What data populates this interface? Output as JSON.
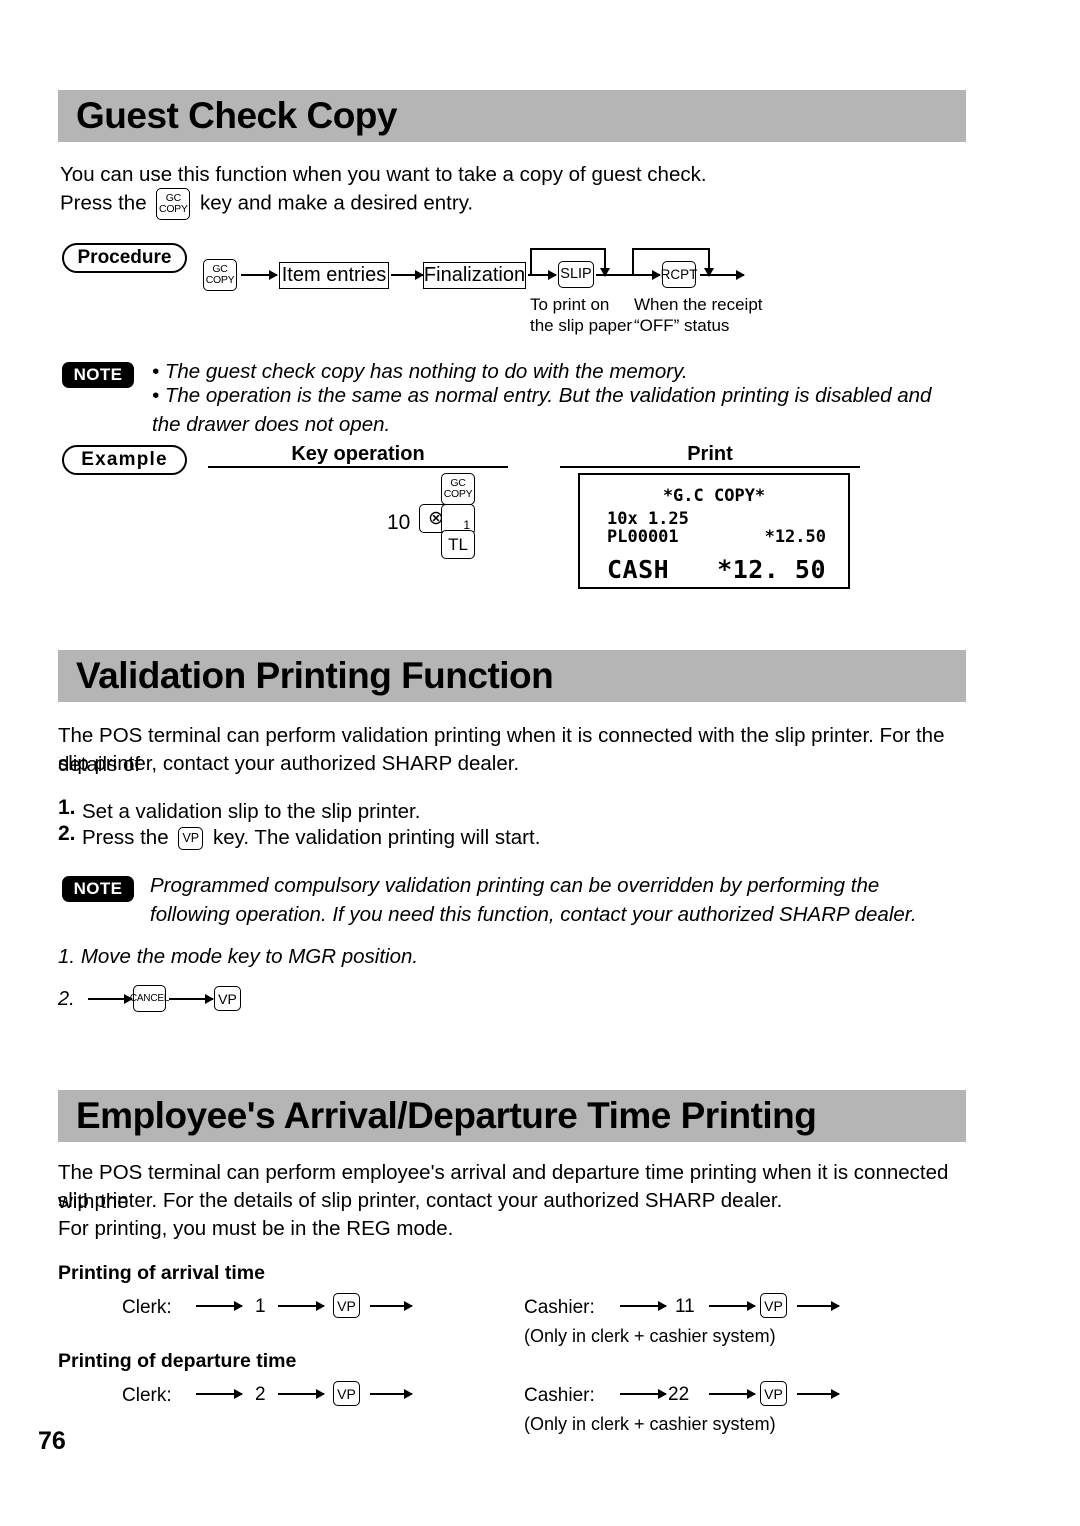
{
  "page": {
    "number": "76",
    "accent_bar_color": "#b5b5b5"
  },
  "sections": [
    {
      "id": "guest-check-copy",
      "title": "Guest Check Copy",
      "paragraphs": [
        "You can use this function when you want to take a copy of guest check.",
        "Press the",
        "key and make a desired entry."
      ],
      "procedure": {
        "badge": "Procedure",
        "keys": {
          "gc_copy_top": "GC",
          "gc_copy_bottom": "COPY",
          "slip": "SLIP",
          "rcpt": "RCPT"
        },
        "boxes": [
          "Item entries",
          "Finalization"
        ],
        "captions": [
          "To print on\nthe slip paper",
          "When the receipt\n“OFF” status"
        ]
      },
      "note": {
        "badge": "NOTE",
        "bullets": [
          "The guest check copy has nothing to do with the memory.",
          "The operation is the same as normal entry.  But the validation printing is disabled and the drawer does not open."
        ]
      },
      "example": {
        "badge": "Example",
        "col_key_operation": "Key operation",
        "col_print": "Print",
        "keys": {
          "quantity": "10",
          "multiply": "⊗",
          "gc_copy_top": "GC",
          "gc_copy_bottom": "COPY",
          "plu": "1",
          "total": "TL"
        },
        "receipt": {
          "title": "*G.C COPY*",
          "line1": "10x 1.25",
          "line2_left": "PL00001",
          "line2_right": "*12.50",
          "total_label": "CASH",
          "total_amount": "*12. 50"
        }
      }
    },
    {
      "id": "validation-printing-function",
      "title": "Validation Printing Function",
      "paragraphs": [
        "The POS terminal can perform validation printing when it is connected with the slip printer. For the details of",
        "slip printer, contact your authorized SHARP dealer."
      ],
      "steps": [
        {
          "num": "1.",
          "text_before": "Set a validation slip to the slip printer.",
          "key": null,
          "text_after": ""
        },
        {
          "num": "2.",
          "text_before": "Press the",
          "key": "VP",
          "text_after": "key. The validation printing will start."
        }
      ],
      "note": {
        "badge": "NOTE",
        "text": "Programmed compulsory validation printing can be overridden by performing the following operation.  If you need this function, contact your authorized SHARP dealer."
      },
      "override_steps": {
        "step1_num": "1.",
        "step1_text": "Move the mode key to MGR position.",
        "step2_num": "2.",
        "step2_keys": [
          "CANCEL",
          "VP"
        ]
      }
    },
    {
      "id": "employee-arrival-departure-time-printing",
      "title": "Employee's Arrival/Departure Time Printing",
      "paragraphs": [
        "The POS terminal can perform employee's arrival and departure time printing when it is connected with the",
        "slip printer.  For the details of slip printer, contact your authorized SHARP dealer.",
        "For printing, you must be in the REG mode."
      ],
      "arrival": {
        "heading": "Printing of arrival time",
        "clerk_label": "Clerk:",
        "clerk_code": "1",
        "clerk_key": "VP",
        "cashier_label": "Cashier:",
        "cashier_code": "11",
        "cashier_key": "VP",
        "cashier_note": "(Only in clerk + cashier system)"
      },
      "departure": {
        "heading": "Printing of departure time",
        "clerk_label": "Clerk:",
        "clerk_code": "2",
        "clerk_key": "VP",
        "cashier_label": "Cashier:",
        "cashier_code": "22",
        "cashier_key": "VP",
        "cashier_note": "(Only in clerk + cashier system)"
      }
    }
  ]
}
